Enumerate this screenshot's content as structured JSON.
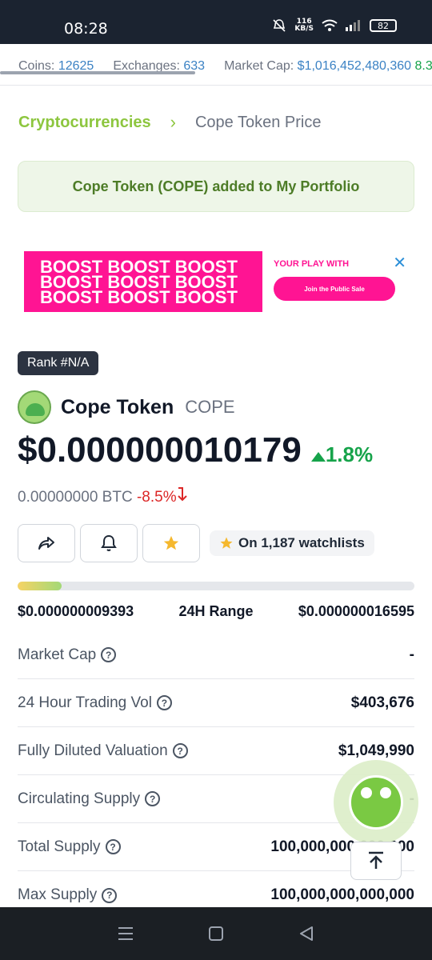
{
  "status_bar": {
    "time": "08:28",
    "net_speed_value": "116",
    "net_speed_unit": "KB/S",
    "battery": "82"
  },
  "ticker": {
    "coins_label": "Coins:",
    "coins_value": "12625",
    "exchanges_label": "Exchanges:",
    "exchanges_value": "633",
    "market_cap_label": "Market Cap:",
    "market_cap_value": "$1,016,452,480,360",
    "market_cap_change": "8.3"
  },
  "breadcrumb": {
    "parent": "Cryptocurrencies",
    "separator": "›",
    "current": "Cope Token Price"
  },
  "toast": {
    "message": "Cope Token (COPE) added to My Portfolio"
  },
  "ad": {
    "line1": "BOOST BOOST BOOST",
    "line2": "BOOST BOOST BOOST",
    "line3": "BOOST BOOST BOOST",
    "tagline": "YOUR PLAY WITH",
    "button": "Join the Public Sale",
    "close": "✕"
  },
  "coin": {
    "rank": "Rank #N/A",
    "name": "Cope Token",
    "symbol": "COPE",
    "price": "$0.000000010179",
    "price_change": "1.8%",
    "btc_price": "0.00000000 BTC",
    "btc_change": "-8.5%",
    "watchlists": "On 1,187 watchlists"
  },
  "range": {
    "low": "$0.000000009393",
    "label": "24H Range",
    "high": "$0.000000016595",
    "fill_percent": 11
  },
  "stats": [
    {
      "label": "Market Cap",
      "value": "-"
    },
    {
      "label": "24 Hour Trading Vol",
      "value": "$403,676"
    },
    {
      "label": "Fully Diluted Valuation",
      "value": "$1,049,990"
    },
    {
      "label": "Circulating Supply",
      "value": "-"
    },
    {
      "label": "Total Supply",
      "value": "100,000,000,000,000"
    },
    {
      "label": "Max Supply",
      "value": "100,000,000,000,000"
    }
  ],
  "colors": {
    "accent": "#8dc63f",
    "positive": "#16a34a",
    "negative": "#dc2626",
    "ad_pink": "#ff1493"
  }
}
